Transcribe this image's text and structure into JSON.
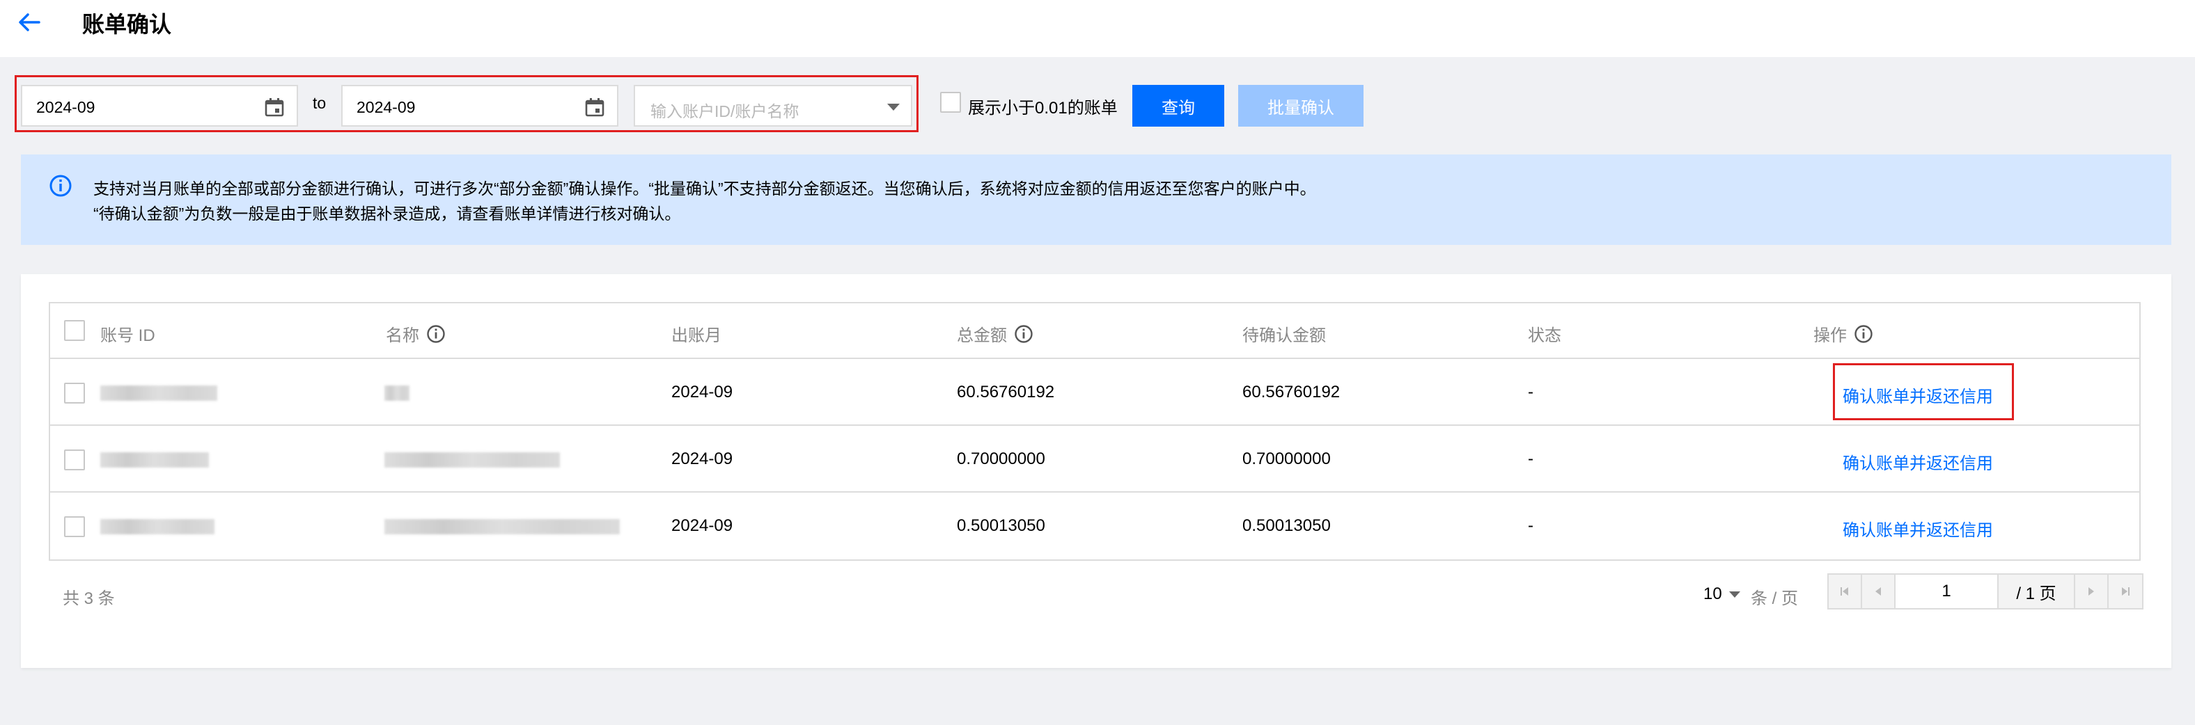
{
  "header": {
    "title": "账单确认"
  },
  "filters": {
    "start_date": "2024-09",
    "to_label": "to",
    "end_date": "2024-09",
    "account_placeholder": "输入账户ID/账户名称",
    "small_bill_label": "展示小于0.01的账单",
    "query_label": "查询",
    "batch_label": "批量确认"
  },
  "notice": {
    "line1": "支持对当月账单的全部或部分金额进行确认，可进行多次“部分金额”确认操作。“批量确认”不支持部分金额返还。当您确认后，系统将对应金额的信用返还至您客户的账户中。",
    "line2": "“待确认金额”为负数一般是由于账单数据补录造成，请查看账单详情进行核对确认。"
  },
  "table": {
    "columns": [
      "账号 ID",
      "名称",
      "出账月",
      "总金额",
      "待确认金额",
      "状态",
      "操作"
    ],
    "rows": [
      {
        "month": "2024-09",
        "total": "60.56760192",
        "pending": "60.56760192",
        "status": "-",
        "action": "确认账单并返还信用"
      },
      {
        "month": "2024-09",
        "total": "0.70000000",
        "pending": "0.70000000",
        "status": "-",
        "action": "确认账单并返还信用"
      },
      {
        "month": "2024-09",
        "total": "0.50013050",
        "pending": "0.50013050",
        "status": "-",
        "action": "确认账单并返还信用"
      }
    ]
  },
  "footer": {
    "total": "共 3 条",
    "page_size": "10",
    "page_unit": "条 / 页",
    "current_page": "1",
    "page_total": "/ 1 页"
  },
  "colors": {
    "primary": "#006eff",
    "disabled": "#99c5ff",
    "notice_bg": "#d5e7ff",
    "highlight": "#e02020"
  }
}
